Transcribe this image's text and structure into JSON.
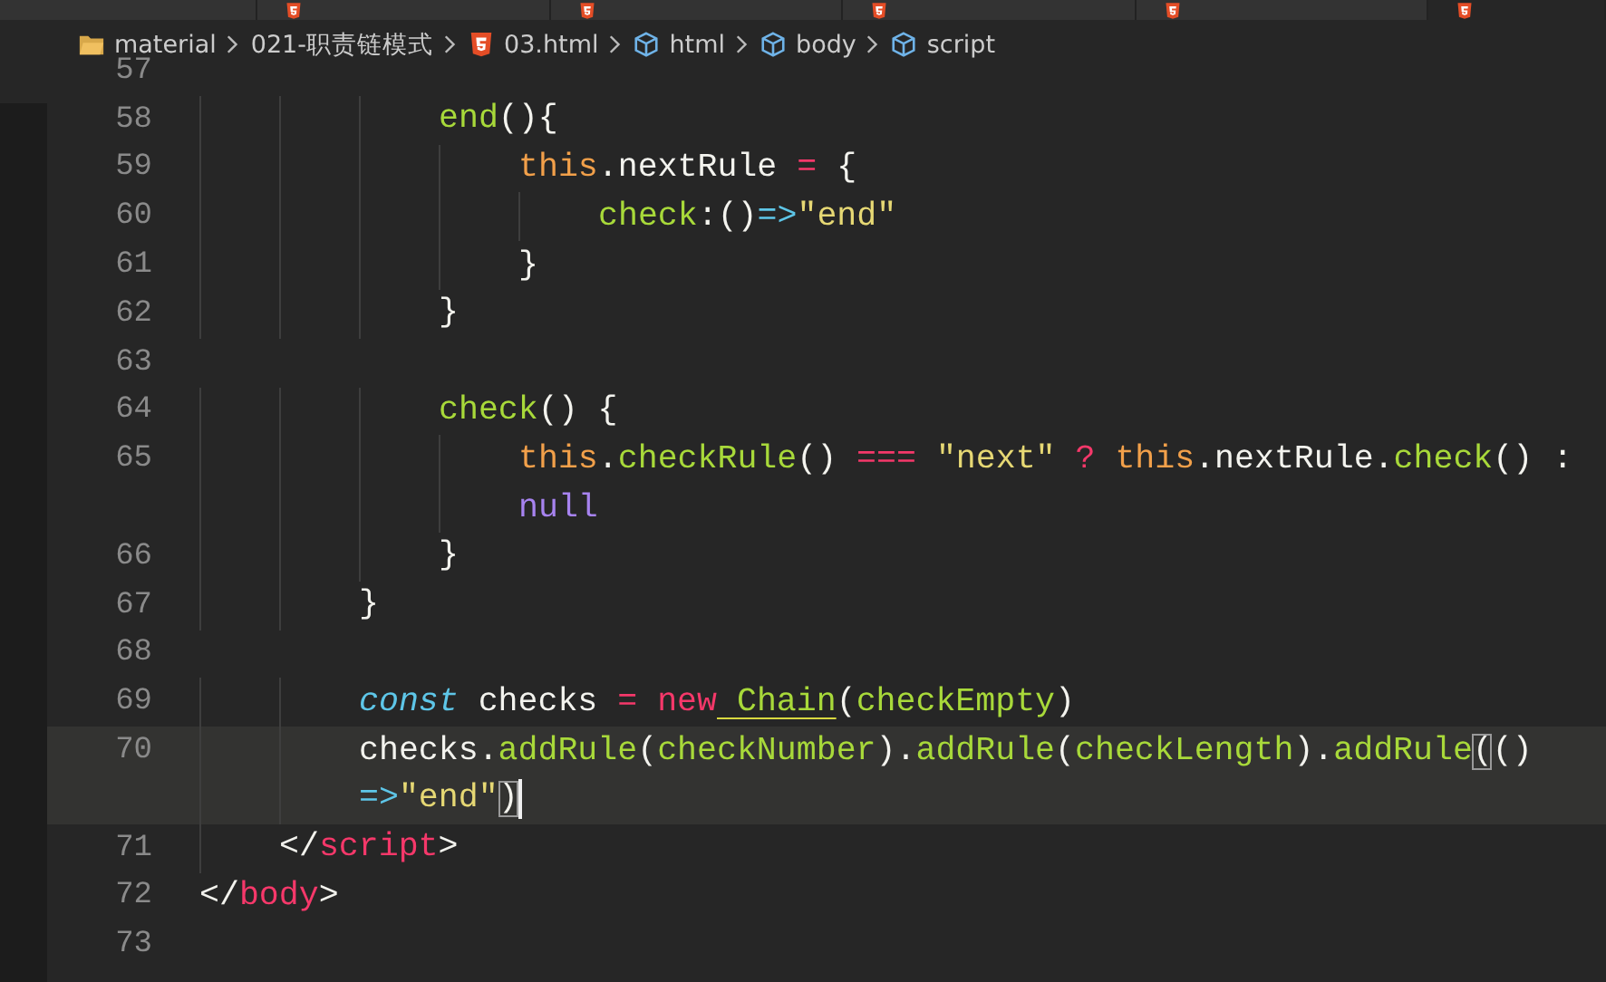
{
  "tabs": [
    {
      "selected": false
    },
    {
      "selected": false
    },
    {
      "selected": false
    },
    {
      "selected": false
    },
    {
      "selected": false
    },
    {
      "selected": true
    }
  ],
  "breadcrumb": [
    {
      "kind": "folder",
      "label": "material"
    },
    {
      "kind": "plain",
      "label": "021-职责链模式"
    },
    {
      "kind": "html",
      "label": "03.html"
    },
    {
      "kind": "element",
      "label": "html"
    },
    {
      "kind": "element",
      "label": "body"
    },
    {
      "kind": "element",
      "label": "script"
    }
  ],
  "lines": [
    {
      "number": "57",
      "selected": false
    },
    {
      "number": "58",
      "selected": false,
      "tokens": [
        {
          "kind": "function",
          "text": "            end"
        },
        {
          "kind": "plain",
          "text": "(){"
        }
      ]
    },
    {
      "number": "59",
      "selected": false,
      "tokens": [
        {
          "kind": "this",
          "text": "                this"
        },
        {
          "kind": "plain",
          "text": ".nextRule"
        },
        {
          "kind": "operator",
          "text": " ="
        },
        {
          "kind": "plain",
          "text": " {"
        }
      ]
    },
    {
      "number": "60",
      "selected": false,
      "tokens": [
        {
          "kind": "function",
          "text": "                    check"
        },
        {
          "kind": "plain",
          "text": ":()"
        },
        {
          "kind": "arrow",
          "text": "=>"
        },
        {
          "kind": "string",
          "text": "\"end\""
        }
      ]
    },
    {
      "number": "61",
      "selected": false,
      "tokens": [
        {
          "kind": "plain",
          "text": "                }"
        }
      ]
    },
    {
      "number": "62",
      "selected": false,
      "tokens": [
        {
          "kind": "plain",
          "text": "            }"
        }
      ]
    },
    {
      "number": "63",
      "selected": false
    },
    {
      "number": "64",
      "selected": false,
      "tokens": [
        {
          "kind": "function",
          "text": "            check"
        },
        {
          "kind": "plain",
          "text": "() {"
        }
      ]
    },
    {
      "number": "65",
      "selected": false,
      "tokens": [
        {
          "kind": "this",
          "text": "                this"
        },
        {
          "kind": "plain",
          "text": "."
        },
        {
          "kind": "function",
          "text": "checkRule"
        },
        {
          "kind": "plain",
          "text": "()"
        },
        {
          "kind": "operator",
          "text": " ==="
        },
        {
          "kind": "string",
          "text": " \"next\""
        },
        {
          "kind": "operator",
          "text": " ?"
        },
        {
          "kind": "this",
          "text": " this"
        },
        {
          "kind": "plain",
          "text": ".nextRule."
        },
        {
          "kind": "function",
          "text": "check"
        },
        {
          "kind": "plain",
          "text": "() :"
        }
      ],
      "continuation": [
        {
          "kind": "null",
          "text": "                null"
        }
      ]
    },
    {
      "number": "66",
      "selected": false,
      "tokens": [
        {
          "kind": "plain",
          "text": "            }"
        }
      ]
    },
    {
      "number": "67",
      "selected": false,
      "tokens": [
        {
          "kind": "plain",
          "text": "        }"
        }
      ]
    },
    {
      "number": "68",
      "selected": false
    },
    {
      "number": "69",
      "selected": false,
      "tokens": [
        {
          "kind": "storage",
          "text": "        const"
        },
        {
          "kind": "plain",
          "text": " checks"
        },
        {
          "kind": "operator",
          "text": " ="
        },
        {
          "kind": "operator",
          "text": " new"
        },
        {
          "kind": "class",
          "text": " Chain"
        },
        {
          "kind": "plain",
          "text": "("
        },
        {
          "kind": "function",
          "text": "checkEmpty"
        },
        {
          "kind": "plain",
          "text": ")"
        }
      ]
    },
    {
      "number": "70",
      "selected": true,
      "tokens": [
        {
          "kind": "plain",
          "text": "        checks."
        },
        {
          "kind": "function",
          "text": "addRule"
        },
        {
          "kind": "plain",
          "text": "("
        },
        {
          "kind": "function",
          "text": "checkNumber"
        },
        {
          "kind": "plain",
          "text": ")."
        },
        {
          "kind": "function",
          "text": "addRule"
        },
        {
          "kind": "plain",
          "text": "("
        },
        {
          "kind": "function",
          "text": "checkLength"
        },
        {
          "kind": "plain",
          "text": ")."
        },
        {
          "kind": "function",
          "text": "addRule"
        },
        {
          "kind": "bracket",
          "text": "("
        },
        {
          "kind": "plain",
          "text": "()"
        }
      ],
      "continuation": [
        {
          "kind": "arrow",
          "text": "        =>"
        },
        {
          "kind": "string",
          "text": "\"end\""
        },
        {
          "kind": "bracket",
          "text": ")"
        }
      ]
    },
    {
      "number": "71",
      "selected": false,
      "tokens": [
        {
          "kind": "plain",
          "text": "    </"
        },
        {
          "kind": "tag",
          "text": "script"
        },
        {
          "kind": "plain",
          "text": ">"
        }
      ]
    },
    {
      "number": "72",
      "selected": false,
      "tokens": [
        {
          "kind": "plain",
          "text": "</"
        },
        {
          "kind": "tag",
          "text": "body"
        },
        {
          "kind": "plain",
          "text": ">"
        }
      ]
    },
    {
      "number": "73",
      "selected": false
    }
  ]
}
